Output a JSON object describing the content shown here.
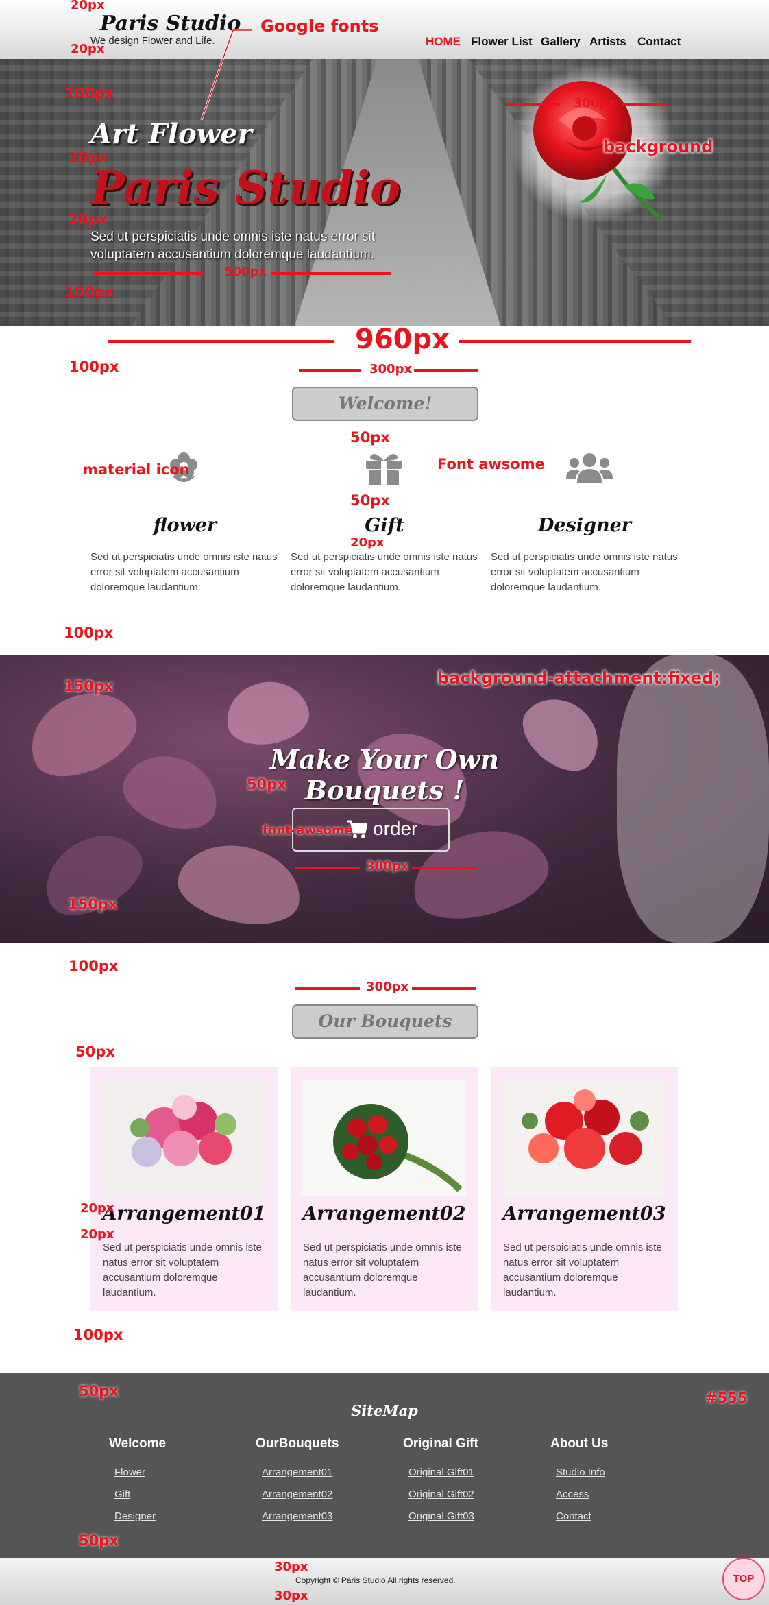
{
  "header": {
    "logo": "Paris Studio",
    "tagline": "We design Flower and Life.",
    "nav": [
      "HOME",
      "Flower List",
      "Gallery",
      "Artists",
      "Contact"
    ]
  },
  "hero": {
    "subtitle": "Art Flower",
    "title": "Paris Studio",
    "text": "Sed ut perspiciatis unde omnis iste natus error sit voluptatem accusantium doloremque laudantium."
  },
  "welcome": {
    "title": "Welcome!",
    "features": [
      {
        "icon": "flower-icon",
        "title": "flower",
        "text": "Sed ut perspiciatis unde omnis iste natus error sit voluptatem accusantium doloremque laudantium."
      },
      {
        "icon": "gift-icon",
        "title": "Gift",
        "text": "Sed ut perspiciatis unde omnis iste natus error sit voluptatem accusantium doloremque laudantium."
      },
      {
        "icon": "users-icon",
        "title": "Designer",
        "text": "Sed ut perspiciatis unde omnis iste natus error sit voluptatem accusantium doloremque laudantium."
      }
    ]
  },
  "band": {
    "title": "Make Your Own Bouquets !",
    "button": "order"
  },
  "bouquets": {
    "title": "Our Bouquets",
    "cards": [
      {
        "title": "Arrangement01",
        "text": "Sed ut perspiciatis unde omnis iste natus error sit voluptatem accusantium doloremque laudantium."
      },
      {
        "title": "Arrangement02",
        "text": "Sed ut perspiciatis unde omnis iste natus error sit voluptatem accusantium doloremque laudantium."
      },
      {
        "title": "Arrangement03",
        "text": "Sed ut perspiciatis unde omnis iste natus error sit voluptatem accusantium doloremque laudantium."
      }
    ]
  },
  "footer": {
    "sitemap": "SiteMap",
    "columns": [
      {
        "heading": "Welcome",
        "items": [
          "Flower",
          "Gift",
          "Designer"
        ]
      },
      {
        "heading": "OurBouquets",
        "items": [
          "Arrangement01",
          "Arrangement02",
          "Arrangement03"
        ]
      },
      {
        "heading": "Original Gift",
        "items": [
          "Original Gift01",
          "Original Gift02",
          "Original Gift03"
        ]
      },
      {
        "heading": "About Us",
        "items": [
          "Studio Info",
          "Access",
          "Contact"
        ]
      }
    ],
    "copyright": "Copyright © Paris Studio All rights reserved.",
    "top_button": "TOP"
  },
  "annotations": {
    "px20": "20px",
    "px30": "30px",
    "px50": "50px",
    "px100": "100px",
    "px150": "150px",
    "px300": "300px",
    "px500": "500px",
    "px960": "960px",
    "google_fonts": "Google fonts",
    "background": "background",
    "material_icon": "material icon",
    "font_awesome": "Font awsome",
    "bg_fixed": "background-attachment:fixed;",
    "font_awsome_small": "font-awsome",
    "color_555": "#555"
  },
  "colors": {
    "accent_red": "#e8141e",
    "footer_bg": "#555",
    "card_bg": "#fde8f8",
    "title_box": "#cccccc"
  }
}
